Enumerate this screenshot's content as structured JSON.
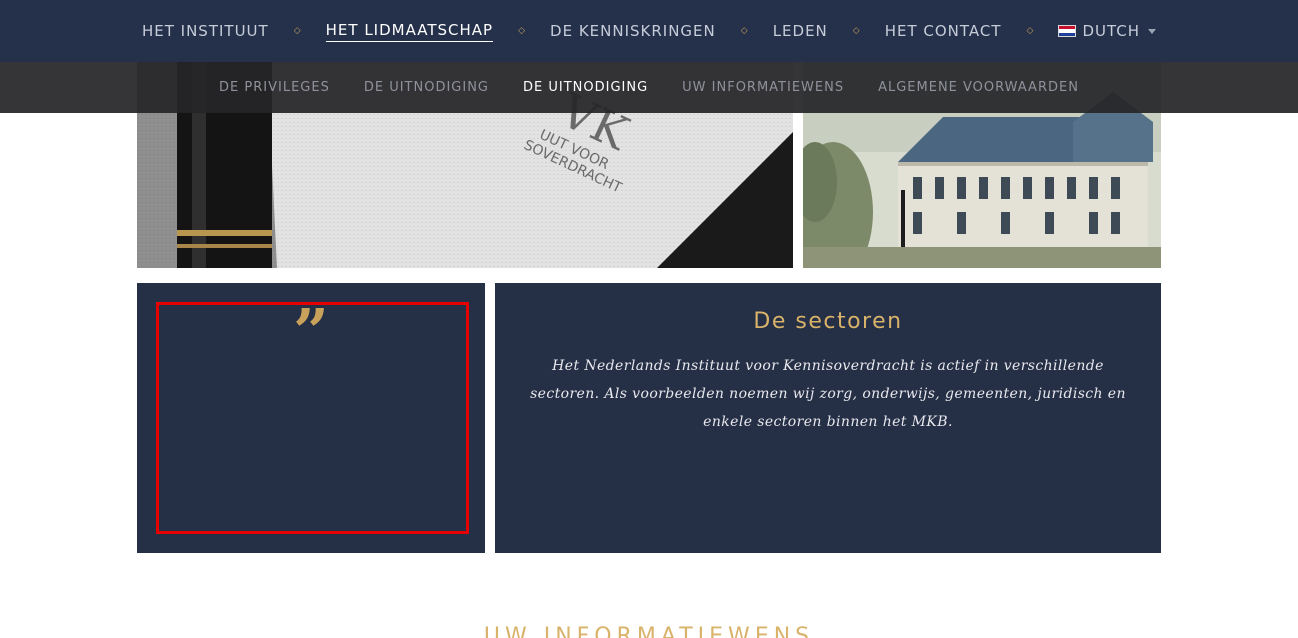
{
  "nav": {
    "items": [
      {
        "label": "HET INSTITUUT"
      },
      {
        "label": "HET LIDMAATSCHAP"
      },
      {
        "label": "DE KENNISKRINGEN"
      },
      {
        "label": "LEDEN"
      },
      {
        "label": "HET CONTACT"
      }
    ],
    "language": "DUTCH"
  },
  "subnav": {
    "items": [
      {
        "label": "DE PRIVILEGES"
      },
      {
        "label": "DE UITNODIGING"
      },
      {
        "label": "DE UITNODIGING"
      },
      {
        "label": "UW INFORMATIEWENS"
      },
      {
        "label": "ALGEMENE VOORWAARDEN"
      }
    ]
  },
  "images": {
    "left_logo_text": "VK",
    "left_sub1": "UUT VOOR",
    "left_sub2": "SOVERDRACHT"
  },
  "quote": {
    "mark": "”"
  },
  "info": {
    "title": "De sectoren",
    "text": "Het Nederlands Instituut voor Kennisoverdracht is actief in verschillende sectoren. Als voorbeelden noemen wij zorg, onderwijs, gemeenten, juridisch en enkele sectoren binnen het MKB."
  },
  "bottom": {
    "heading": "UW INFORMATIEWENS"
  },
  "colors": {
    "navy": "#25304a",
    "panel": "#252f45",
    "gold": "#c8a15a",
    "highlight": "#e60000"
  }
}
